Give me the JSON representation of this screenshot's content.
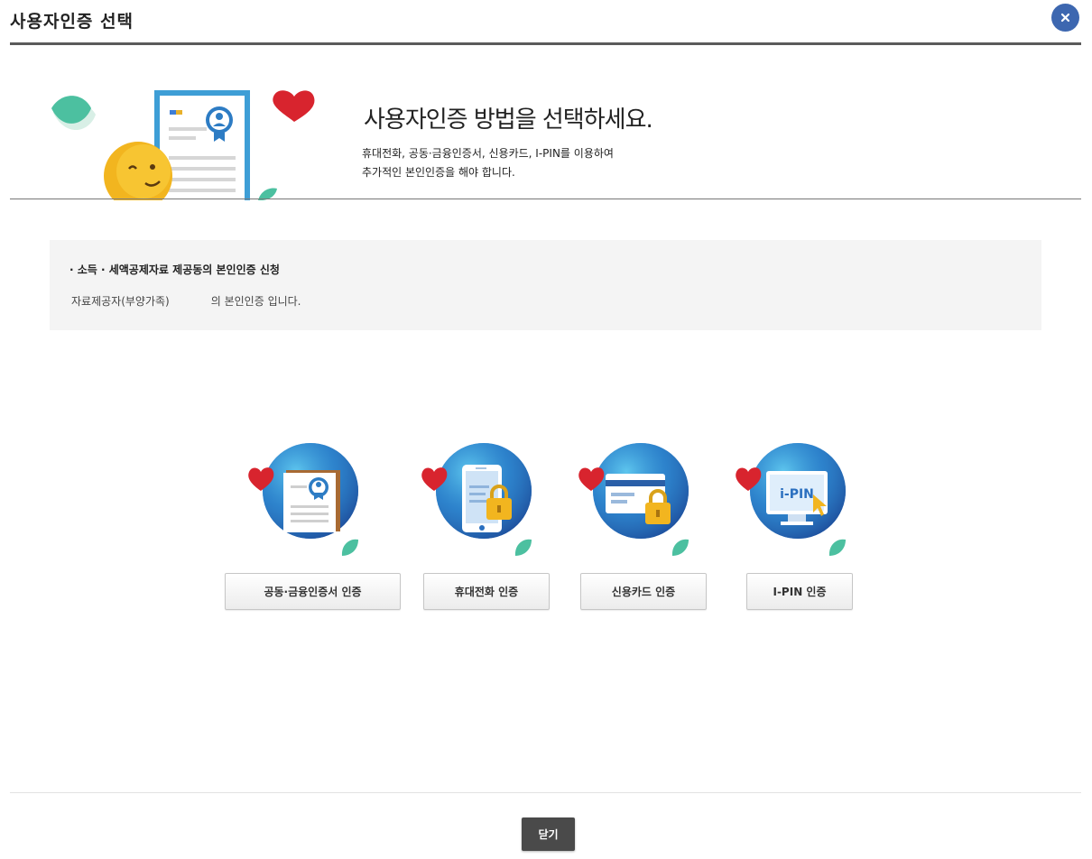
{
  "header": {
    "title": "사용자인증 선택",
    "close_icon": "close-icon"
  },
  "banner": {
    "heading": "사용자인증 방법을 선택하세요.",
    "desc_line1": "휴대전화, 공동·금융인증서, 신용카드, I-PIN를 이용하여",
    "desc_line2": "추가적인 본인인증을 해야 합니다."
  },
  "notice": {
    "title": "· 소득 · 세액공제자료 제공동의 본인인증 신청",
    "body_prefix": "자료제공자(부양가족)",
    "body_suffix": "의 본인인증 입니다."
  },
  "methods": [
    {
      "icon": "certificate-icon",
      "label": "공동·금융인증서 인증"
    },
    {
      "icon": "mobile-phone-icon",
      "label": "휴대전화 인증"
    },
    {
      "icon": "credit-card-icon",
      "label": "신용카드 인증"
    },
    {
      "icon": "ipin-monitor-icon",
      "label": "I-PIN 인증",
      "icon_text": "i-PIN"
    }
  ],
  "footer": {
    "close_label": "닫기"
  },
  "colors": {
    "accent_blue": "#3d67b0",
    "dark_button": "#4a4a4a",
    "notice_bg": "#f4f4f4",
    "heart_red": "#d8242e",
    "leaf_green": "#3cb898"
  }
}
